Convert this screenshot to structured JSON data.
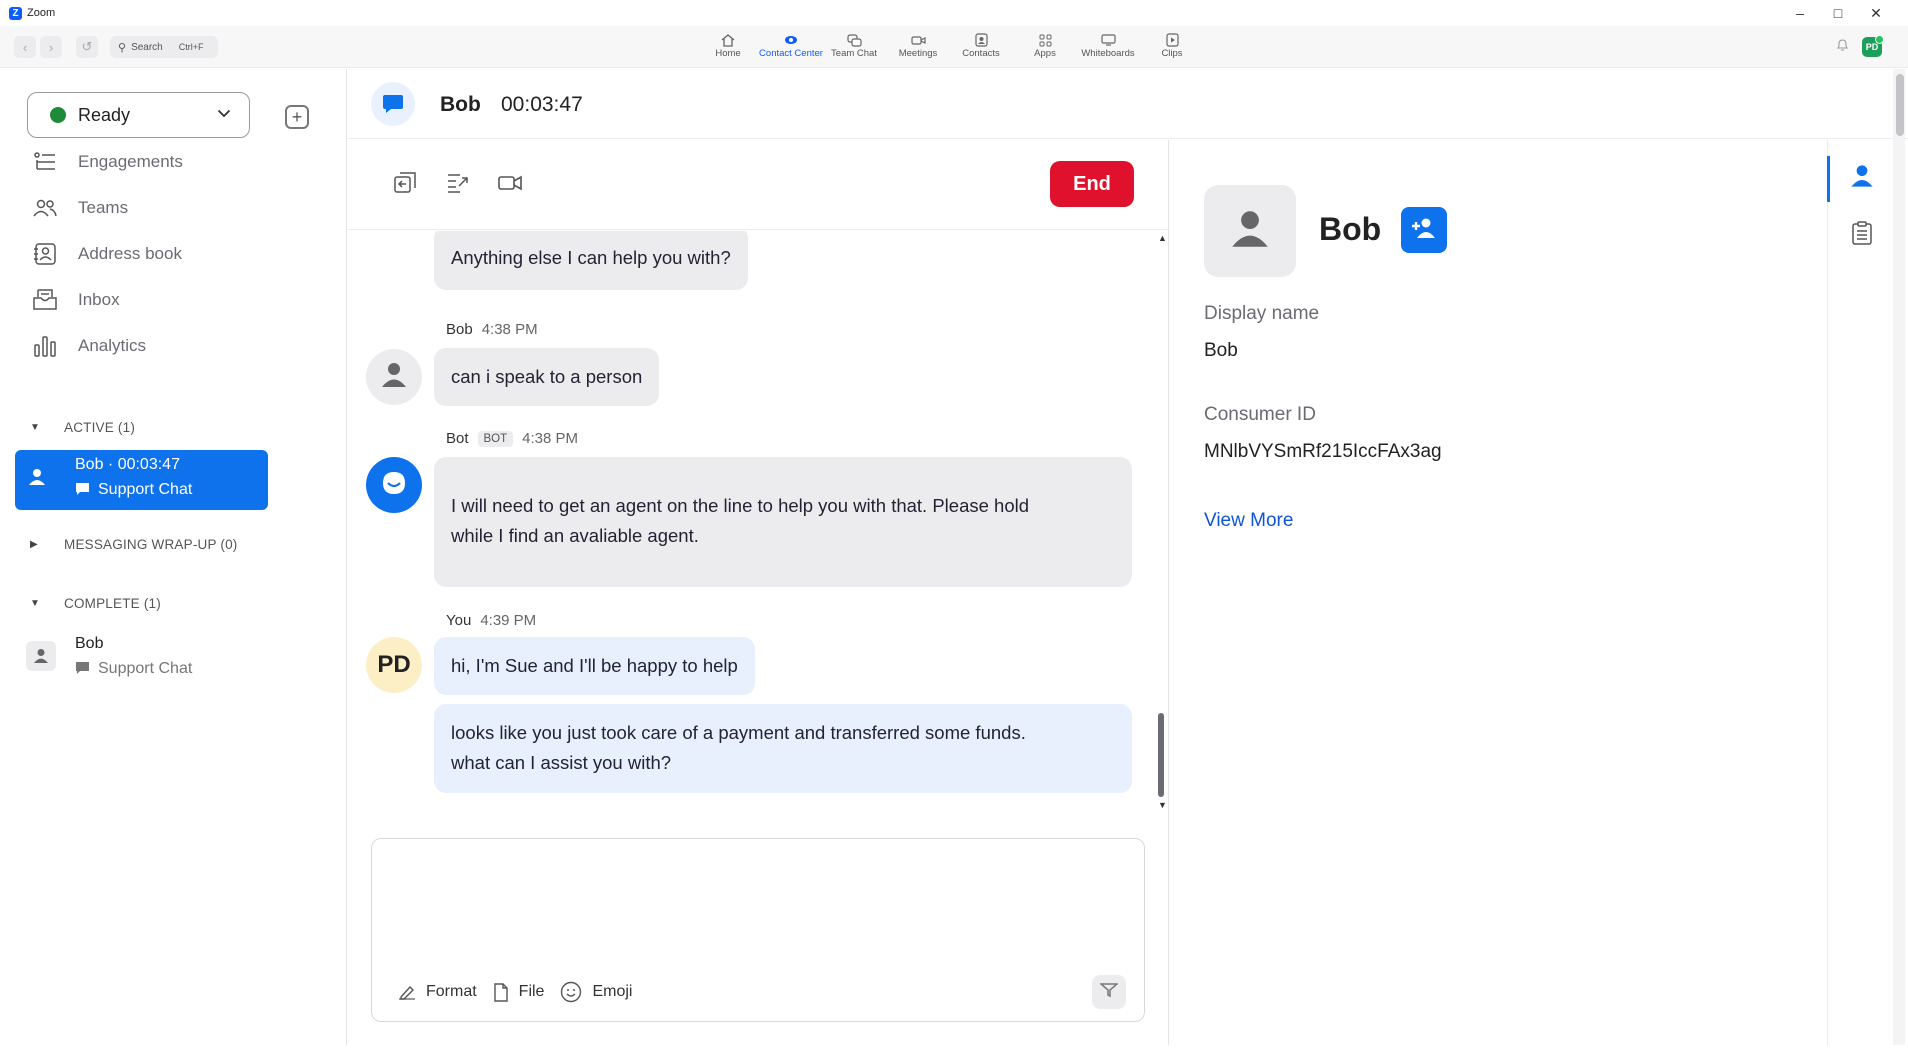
{
  "window": {
    "title": "Zoom"
  },
  "toolbar": {
    "search_label": "Search",
    "search_shortcut": "Ctrl+F",
    "tabs": [
      {
        "label": "Home",
        "icon": "home-icon"
      },
      {
        "label": "Contact Center",
        "icon": "contact-center-icon",
        "active": true
      },
      {
        "label": "Team Chat",
        "icon": "team-chat-icon"
      },
      {
        "label": "Meetings",
        "icon": "meetings-icon"
      },
      {
        "label": "Contacts",
        "icon": "contacts-icon"
      },
      {
        "label": "Apps",
        "icon": "apps-icon"
      },
      {
        "label": "Whiteboards",
        "icon": "whiteboards-icon"
      },
      {
        "label": "Clips",
        "icon": "clips-icon"
      }
    ],
    "avatar_initials": "PD"
  },
  "sidebar": {
    "status": "Ready",
    "status_color": "#1f8a3a",
    "nav": [
      {
        "label": "Engagements",
        "icon": "engagements-icon"
      },
      {
        "label": "Teams",
        "icon": "teams-icon"
      },
      {
        "label": "Address book",
        "icon": "address-book-icon"
      },
      {
        "label": "Inbox",
        "icon": "inbox-icon"
      },
      {
        "label": "Analytics",
        "icon": "analytics-icon"
      }
    ],
    "sections": {
      "active": "ACTIVE (1)",
      "wrapup": "MESSAGING WRAP-UP (0)",
      "complete": "COMPLETE (1)"
    },
    "active_conv": {
      "title": "Bob · 00:03:47",
      "subtitle": "Support Chat"
    },
    "complete_conv": {
      "title": "Bob",
      "subtitle": "Support Chat"
    }
  },
  "conversation": {
    "name": "Bob",
    "timer": "00:03:47",
    "end_label": "End",
    "messages": [
      {
        "text": "Anything else I can help you with?"
      },
      {
        "sender": "Bob",
        "time": "4:38 PM",
        "text": "can i speak to a person"
      },
      {
        "sender": "Bot",
        "tag": "BOT",
        "time": "4:38 PM",
        "text_line1": "I will need to get an agent on the line to help you with that. Please hold",
        "text_line2": "while I find an avaliable agent."
      },
      {
        "sender": "You",
        "time": "4:39 PM",
        "avatar": "PD",
        "text": "hi, I'm Sue and I'll be happy to help"
      },
      {
        "text_line1": "looks like you just took care of a payment and transferred some funds.",
        "text_line2": "what can I assist you with?"
      }
    ],
    "composer": {
      "format_label": "Format",
      "file_label": "File",
      "emoji_label": "Emoji"
    }
  },
  "profile": {
    "name": "Bob",
    "display_name_label": "Display name",
    "display_name": "Bob",
    "consumer_id_label": "Consumer ID",
    "consumer_id": "MNlbVYSmRf215IccFAx3ag",
    "view_more": "View More"
  },
  "colors": {
    "accent": "#0e72ed",
    "end": "#e0112d"
  }
}
